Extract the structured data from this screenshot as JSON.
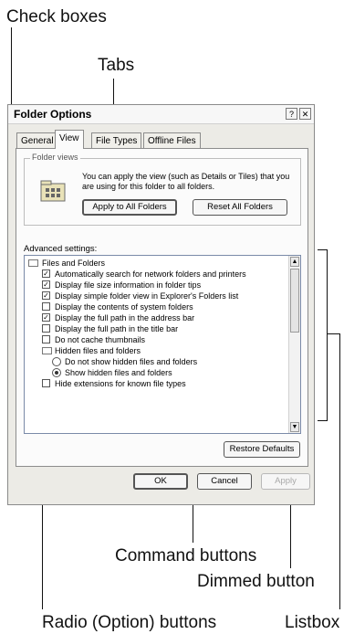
{
  "callouts": {
    "check_boxes": "Check boxes",
    "tabs": "Tabs",
    "command_buttons": "Command buttons",
    "dimmed_button": "Dimmed button",
    "radio_buttons": "Radio (Option) buttons",
    "listbox": "Listbox"
  },
  "dialog": {
    "title": "Folder Options",
    "help_glyph": "?",
    "close_glyph": "✕",
    "tabs": [
      "General",
      "View",
      "File Types",
      "Offline Files"
    ],
    "active_tab": "View",
    "folder_views": {
      "label": "Folder views",
      "description": "You can apply the view (such as Details or Tiles) that you are using for this folder to all folders.",
      "apply_all": "Apply to All Folders",
      "reset_all": "Reset All Folders"
    },
    "advanced_label": "Advanced settings:",
    "list": [
      {
        "type": "folder",
        "label": "Files and Folders"
      },
      {
        "type": "check",
        "checked": true,
        "label": "Automatically search for network folders and printers"
      },
      {
        "type": "check",
        "checked": true,
        "label": "Display file size information in folder tips"
      },
      {
        "type": "check",
        "checked": true,
        "label": "Display simple folder view in Explorer's Folders list"
      },
      {
        "type": "check",
        "checked": false,
        "label": "Display the contents of system folders"
      },
      {
        "type": "check",
        "checked": true,
        "label": "Display the full path in the address bar"
      },
      {
        "type": "check",
        "checked": false,
        "label": "Display the full path in the title bar"
      },
      {
        "type": "check",
        "checked": false,
        "label": "Do not cache thumbnails"
      },
      {
        "type": "folder",
        "label": "Hidden files and folders"
      },
      {
        "type": "radio",
        "selected": false,
        "label": "Do not show hidden files and folders"
      },
      {
        "type": "radio",
        "selected": true,
        "label": "Show hidden files and folders"
      },
      {
        "type": "check",
        "checked": false,
        "label": "Hide extensions for known file types"
      }
    ],
    "restore_defaults": "Restore Defaults",
    "ok": "OK",
    "cancel": "Cancel",
    "apply": "Apply"
  }
}
